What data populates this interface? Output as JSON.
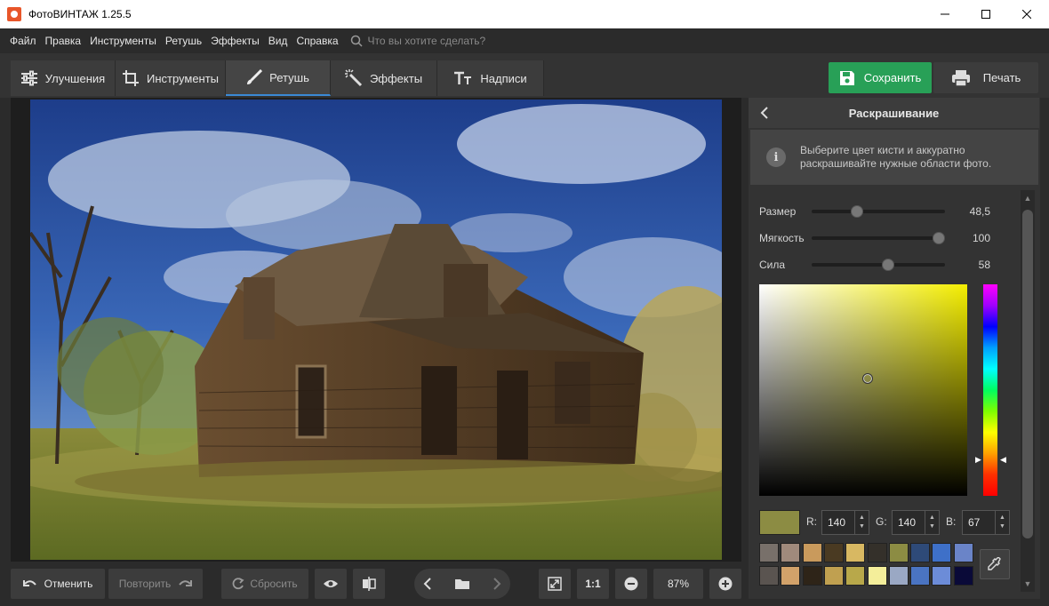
{
  "window": {
    "title": "ФотоВИНТАЖ 1.25.5"
  },
  "menu": {
    "items": [
      "Файл",
      "Правка",
      "Инструменты",
      "Ретушь",
      "Эффекты",
      "Вид",
      "Справка"
    ],
    "search_placeholder": "Что вы хотите сделать?"
  },
  "tabs": [
    {
      "label": "Улучшения",
      "icon": "sliders-icon"
    },
    {
      "label": "Инструменты",
      "icon": "crop-icon"
    },
    {
      "label": "Ретушь",
      "icon": "brush-icon",
      "active": true
    },
    {
      "label": "Эффекты",
      "icon": "magic-wand-icon"
    },
    {
      "label": "Надписи",
      "icon": "text-icon"
    }
  ],
  "toolbar": {
    "save_label": "Сохранить",
    "print_label": "Печать"
  },
  "bottom": {
    "undo_label": "Отменить",
    "redo_label": "Повторить",
    "reset_label": "Сбросить",
    "one_to_one": "1:1",
    "zoom": "87%"
  },
  "panel": {
    "title": "Раскрашивание",
    "hint": "Выберите цвет кисти и аккуратно раскрашивайте нужные области фото.",
    "sliders": [
      {
        "label": "Размер",
        "value": "48,5",
        "fraction": 0.34
      },
      {
        "label": "Мягкость",
        "value": "100",
        "fraction": 0.95
      },
      {
        "label": "Сила",
        "value": "58",
        "fraction": 0.57
      }
    ],
    "rgb": {
      "r_label": "R:",
      "r": "140",
      "g_label": "G:",
      "g": "140",
      "b_label": "B:",
      "b": "67"
    },
    "current_color": "#8c8c43",
    "hue_color": "#f4ee00",
    "palette_row1": [
      "#78706a",
      "#a08a7c",
      "#c99a5c",
      "#4a3a22",
      "#d8b862",
      "#34302a",
      "#8c8c43",
      "#2e4a78",
      "#3e70c8",
      "#6a84c8"
    ],
    "palette_row2": [
      "#5a5450",
      "#d2a26a",
      "#2e2418",
      "#c0a050",
      "#b8a84a",
      "#f4ee9a",
      "#9aa8c4",
      "#4a74c2",
      "#6c8cd8",
      "#0a0a38"
    ]
  }
}
